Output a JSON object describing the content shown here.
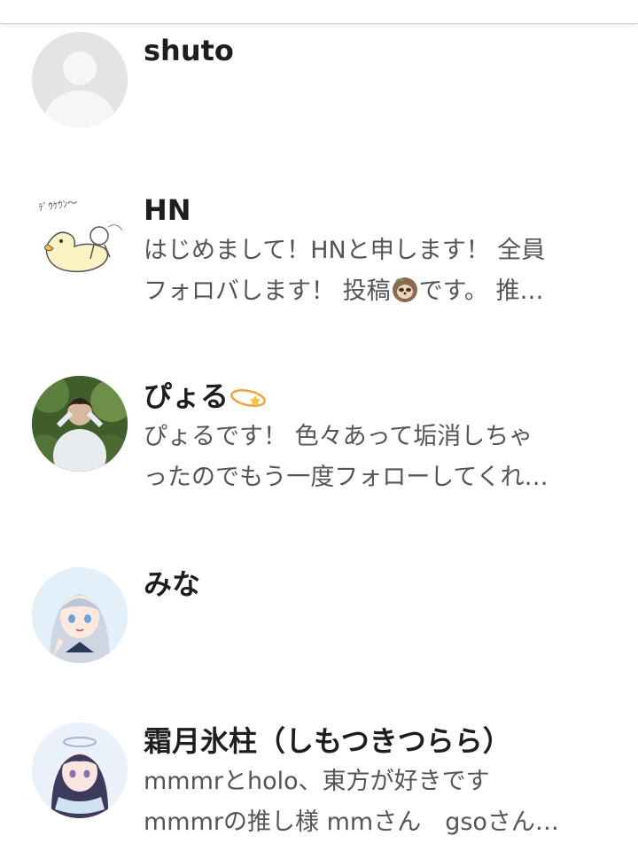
{
  "users": [
    {
      "name": "shuto",
      "bio_lines": [],
      "avatar": "default-person-avatar"
    },
    {
      "name": "HN",
      "bio_lines": [
        "はじめまして！HNと申します！ 全員",
        "フォロバします！ 投稿",
        "です。 推…"
      ],
      "bio_icon": "sloth-emoji-icon",
      "avatar": "duck-doodle-avatar",
      "avatar_doodle_text": "ﾃﾞｳｹｳﾝ〜"
    },
    {
      "name": "ぴょる",
      "name_icon": "dizzy-star-emoji-icon",
      "bio_lines": [
        "ぴょるです！ 色々あって垢消しちゃ",
        "ったのでもう一度フォローしてくれ…"
      ],
      "avatar": "photo-person-forest-avatar"
    },
    {
      "name": "みな",
      "bio_lines": [],
      "avatar": "anime-girl-silver-hair-avatar"
    },
    {
      "name": "霜月氷柱（しもつきつらら）",
      "bio_lines": [
        "mmmrとholo、東方が好きです",
        "mmmrの推し様 mmさん　gsoさん…"
      ],
      "avatar": "anime-girl-dark-hair-avatar"
    }
  ],
  "colors": {
    "name": "#1e1e1e",
    "bio": "#555555",
    "default_avatar_bg": "#e6e6e6",
    "default_avatar_fg": "#f7f7f7"
  }
}
